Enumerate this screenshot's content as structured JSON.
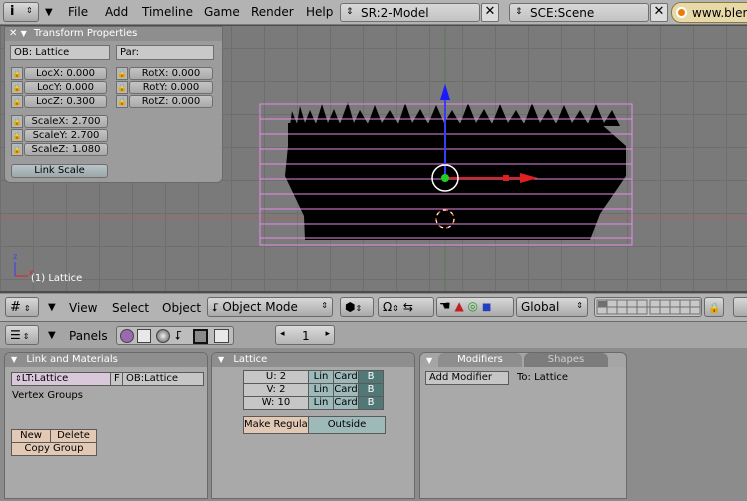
{
  "topbar": {
    "menus": [
      "File",
      "Add",
      "Timeline",
      "Game",
      "Render",
      "Help"
    ],
    "screen_field": "SR:2-Model",
    "scene_field": "SCE:Scene",
    "url": "www.bler"
  },
  "transform_panel": {
    "title": "Transform Properties",
    "ob_field": "OB: Lattice",
    "par_field": "Par:",
    "loc": [
      "LocX: 0.000",
      "LocY: 0.000",
      "LocZ: 0.300"
    ],
    "rot": [
      "RotX: 0.000",
      "RotY: 0.000",
      "RotZ: 0.000"
    ],
    "scale": [
      "ScaleX: 2.700",
      "ScaleY: 2.700",
      "ScaleZ: 1.080"
    ],
    "link_scale": "Link Scale"
  },
  "viewport": {
    "object_label": "(1) Lattice"
  },
  "view_header": {
    "view": "View",
    "select": "Select",
    "object": "Object",
    "mode": "Object Mode",
    "orientation": "Global"
  },
  "buttons_header": {
    "panels": "Panels",
    "frame": "1"
  },
  "link_materials": {
    "title": "Link and Materials",
    "lt_field": "LT:Lattice",
    "f_label": "F",
    "ob_field": "OB:Lattice",
    "vertex_groups": "Vertex Groups",
    "new": "New",
    "delete": "Delete",
    "copy_group": "Copy Group"
  },
  "lattice": {
    "title": "Lattice",
    "rows": [
      {
        "label": "U: 2",
        "lin": "Lin",
        "card": "Card",
        "b": "B"
      },
      {
        "label": "V: 2",
        "lin": "Lin",
        "card": "Card",
        "b": "B"
      },
      {
        "label": "W: 10",
        "lin": "Lin",
        "card": "Card",
        "b": "B"
      }
    ],
    "make_regular": "Make Regular",
    "outside": "Outside"
  },
  "modifiers": {
    "tab_modifiers": "Modifiers",
    "tab_shapes": "Shapes",
    "add_modifier": "Add Modifier",
    "to_label": "To: Lattice"
  }
}
